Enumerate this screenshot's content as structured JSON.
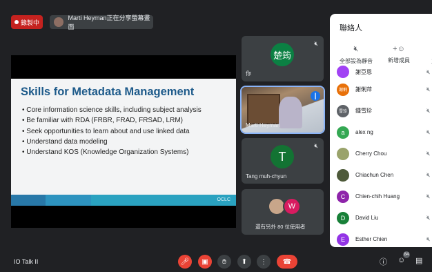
{
  "top": {
    "recording_label": "錄製中",
    "presenting_text": "Marti Heyman正在分享螢幕畫面"
  },
  "slide": {
    "title": "Skills for Metadata Management",
    "bullets": [
      "Core information science skills, including subject analysis",
      "Be familiar with RDA (FRBR, FRAD, FRSAD, LRM)",
      "Seek opportunities to learn about and use linked data",
      "Understand data modeling",
      "Understand KOS (Knowledge Organization Systems)"
    ],
    "logo": "OCLC"
  },
  "tiles": {
    "self": {
      "avatar": "楚筠",
      "name": "你",
      "avatar_color": "#0b8043"
    },
    "speaker": {
      "name": "Marti Heyman"
    },
    "tang": {
      "avatar": "T",
      "name": "Tang muh-chyun",
      "avatar_color": "#137333"
    },
    "others": {
      "avatar": "W",
      "text": "還有另外 80 位使用者",
      "avatar_color": "#d81b60"
    }
  },
  "bottom": {
    "meeting_name": "IO Talk II",
    "participant_count": "84"
  },
  "panel": {
    "title": "聯絡人",
    "actions": [
      {
        "icon": "mute-all-icon",
        "label": "全部設為靜音"
      },
      {
        "icon": "add-person-icon",
        "label": "新增成員"
      },
      {
        "icon": "host-controls-icon",
        "label": "主辦"
      }
    ],
    "participants": [
      {
        "initials": "",
        "name": "謝亞恩",
        "color": "#a142f4"
      },
      {
        "initials": "謝俐",
        "name": "謝俐萍",
        "color": "#e8710a"
      },
      {
        "initials": "雪珍",
        "name": "鍾雪珍",
        "color": "#5f6368"
      },
      {
        "initials": "a",
        "name": "alex ng",
        "color": "#34a853"
      },
      {
        "initials": "",
        "name": "Cherry Chou",
        "color": "#9aa36b"
      },
      {
        "initials": "",
        "name": "Chiachun Chen",
        "color": "#4e5a3a"
      },
      {
        "initials": "C",
        "name": "Chien-chih Huang",
        "color": "#8e24aa"
      },
      {
        "initials": "D",
        "name": "David Liu",
        "color": "#188038"
      },
      {
        "initials": "E",
        "name": "Esther Chien",
        "color": "#9334e6"
      }
    ]
  }
}
